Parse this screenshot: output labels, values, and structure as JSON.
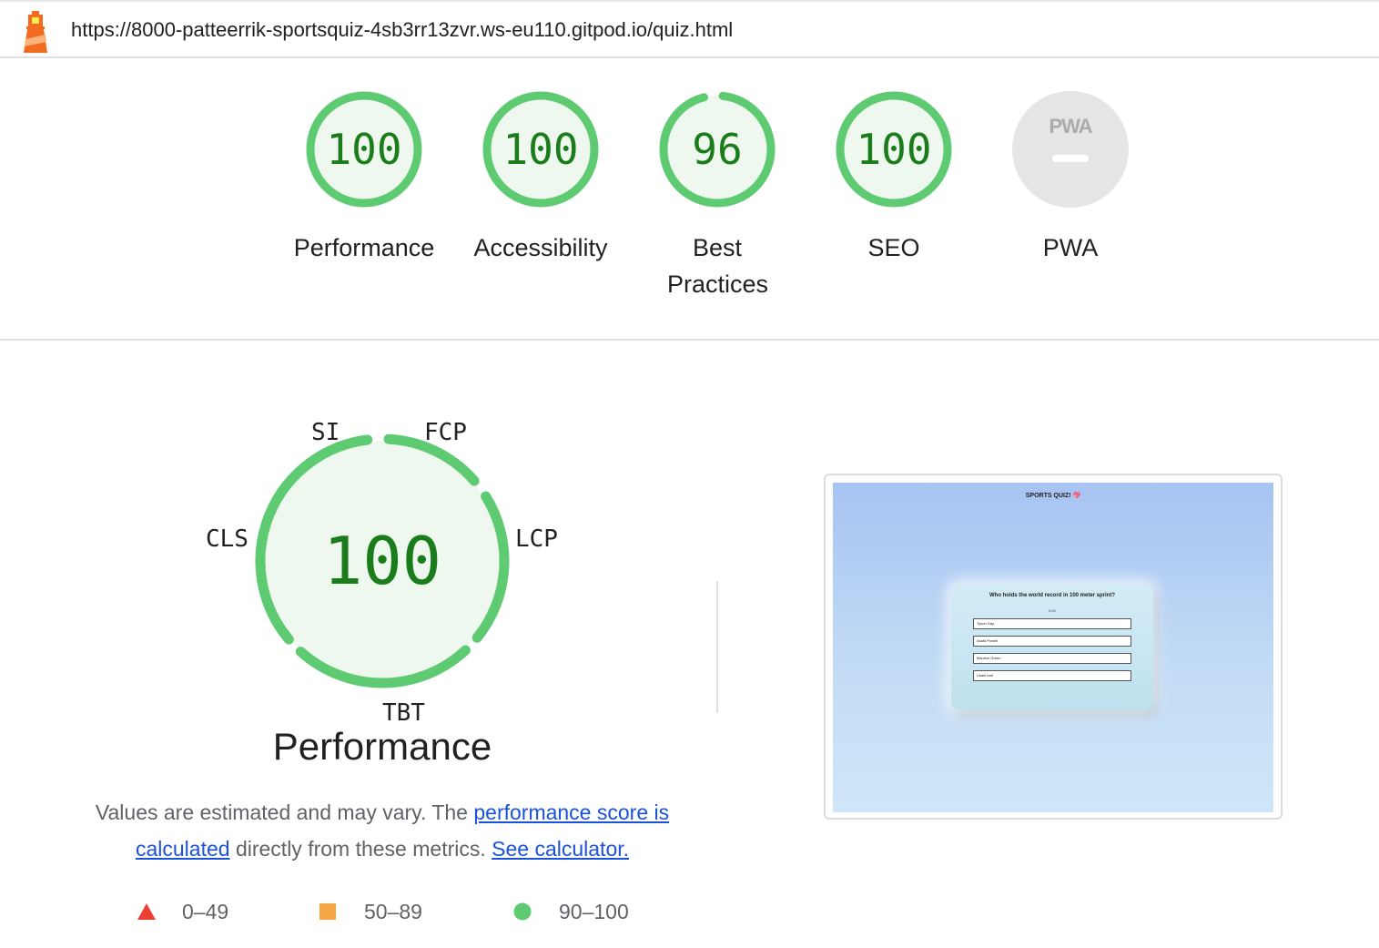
{
  "header": {
    "url": "https://8000-patteerrik-sportsquiz-4sb3rr13zvr.ws-eu110.gitpod.io/quiz.html",
    "logo_icon": "lighthouse-icon"
  },
  "scores": [
    {
      "label": "Performance",
      "score": "100",
      "fraction": 1.0
    },
    {
      "label": "Accessibility",
      "score": "100",
      "fraction": 1.0
    },
    {
      "label": "Best Practices",
      "score": "96",
      "fraction": 0.96
    },
    {
      "label": "SEO",
      "score": "100",
      "fraction": 1.0
    },
    {
      "label": "PWA",
      "score": "",
      "badge": "PWA"
    }
  ],
  "performance": {
    "score": "100",
    "title": "Performance",
    "metrics": [
      "SI",
      "FCP",
      "LCP",
      "TBT",
      "CLS"
    ],
    "description_prefix": "Values are estimated and may vary. The ",
    "link_score": "performance score is calculated",
    "description_middle": " directly from these metrics. ",
    "link_calculator": "See calculator.",
    "legend": [
      {
        "range": "0–49",
        "shape": "triangle",
        "color": "#eb4134"
      },
      {
        "range": "50–89",
        "shape": "square",
        "color": "#f5a644"
      },
      {
        "range": "90–100",
        "shape": "circle",
        "color": "#5ecb73"
      }
    ]
  },
  "screenshot": {
    "heading": "SPORTS QUIZ! 💖",
    "question": "Who holds the world record in 100 meter sprint?",
    "timer": "0:00",
    "answers": [
      "Tyson Gay",
      "Asafa Powell",
      "Maurice Green",
      "Usain bolt"
    ]
  },
  "colors": {
    "pass_ring": "#5ecb73",
    "pass_fill": "#eef8ee",
    "pass_text": "#1b7c1b",
    "link": "#1a52d9"
  }
}
